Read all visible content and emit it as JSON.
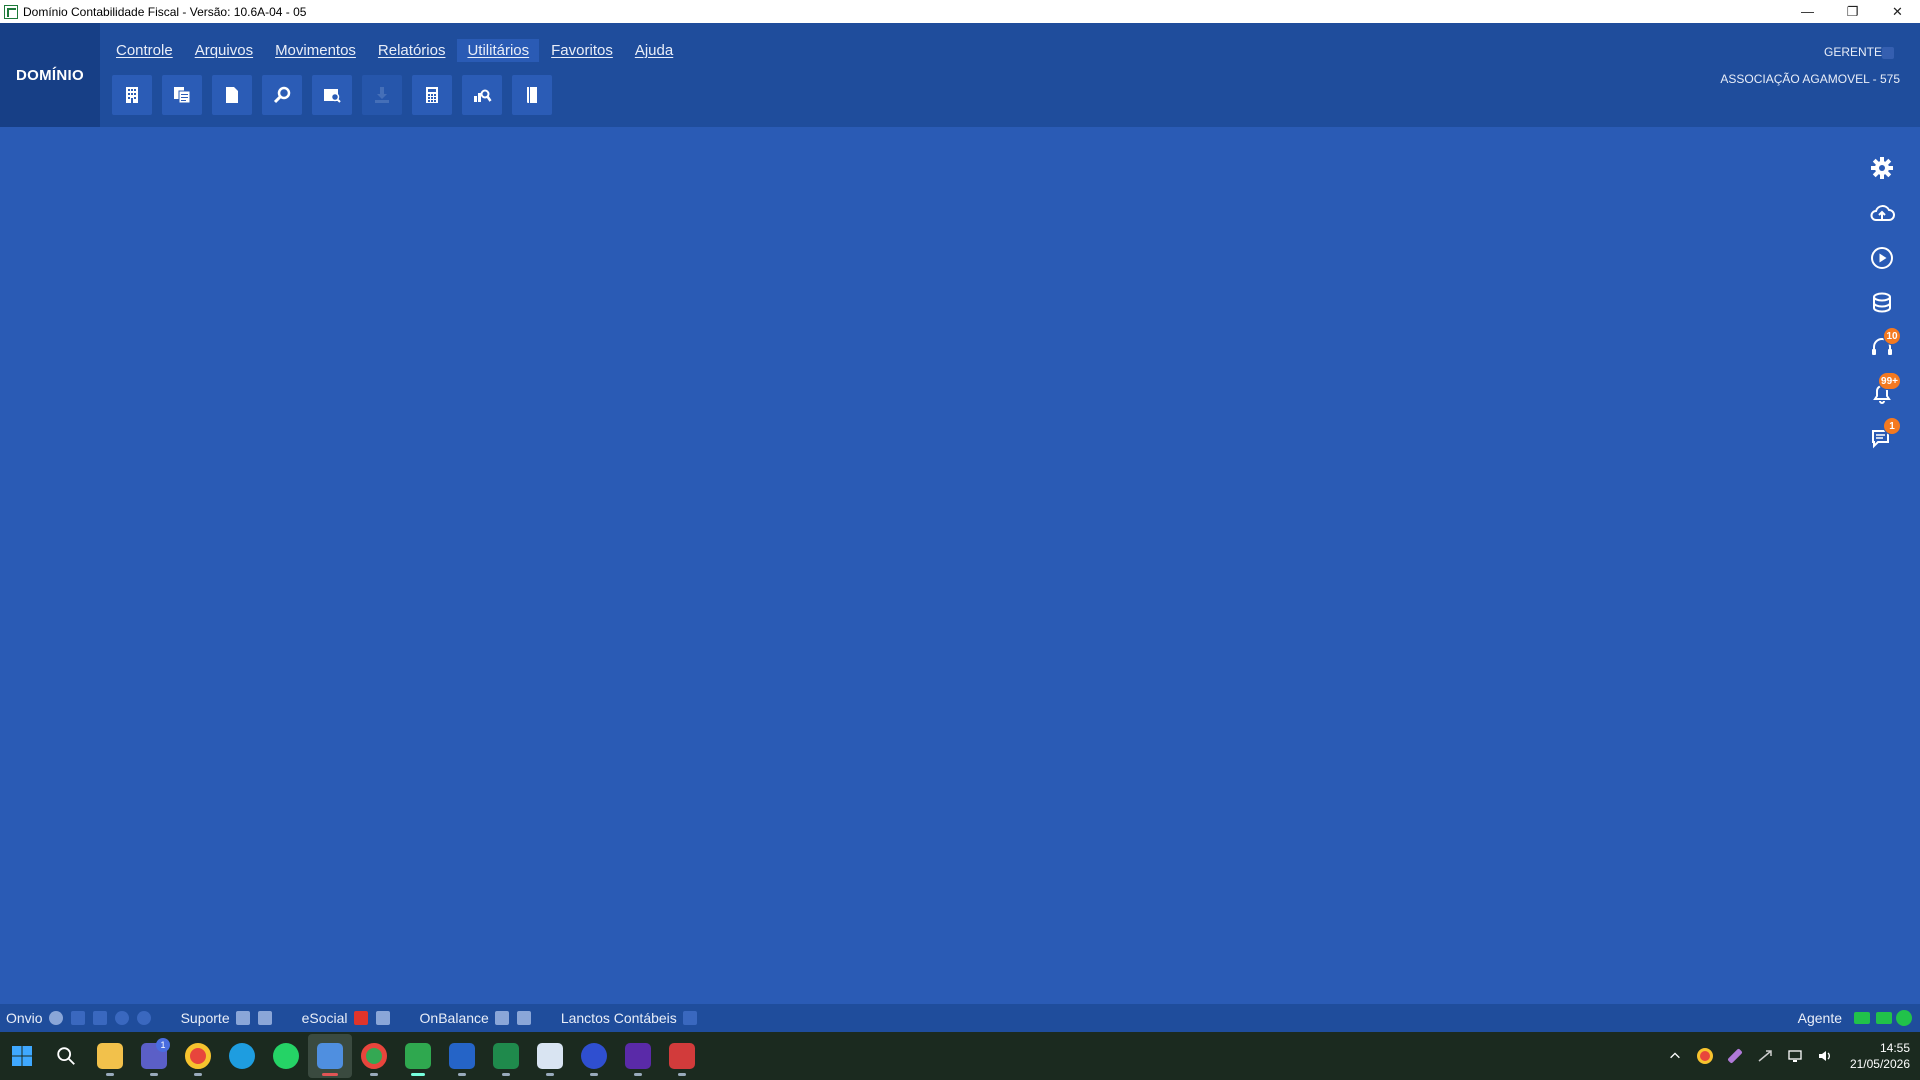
{
  "window": {
    "title": "Domínio Contabilidade Fiscal  - Versão: 10.6A-04 - 05",
    "minimize": "—",
    "restore": "❐",
    "close": "✕"
  },
  "brand": "DOMÍNIO",
  "menu": [
    {
      "label": "Controle"
    },
    {
      "label": "Arquivos"
    },
    {
      "label": "Movimentos"
    },
    {
      "label": "Relatórios"
    },
    {
      "label": "Utilitários"
    },
    {
      "label": "Favoritos"
    },
    {
      "label": "Ajuda"
    }
  ],
  "toolbar_icons": [
    "building-icon",
    "copy-document-icon",
    "document-icon",
    "search-icon",
    "find-document-icon",
    "download-icon",
    "calculator-icon",
    "chart-search-icon",
    "book-icon"
  ],
  "user": {
    "role": "GERENTE",
    "company": "ASSOCIAÇÃO AGAMOVEL  - 575"
  },
  "side_icons": [
    {
      "name": "gear-icon",
      "badge": ""
    },
    {
      "name": "cloud-upload-icon",
      "badge": ""
    },
    {
      "name": "play-circle-icon",
      "badge": ""
    },
    {
      "name": "database-icon",
      "badge": ""
    },
    {
      "name": "headset-icon",
      "badge": "10"
    },
    {
      "name": "bell-icon",
      "badge": "99+"
    },
    {
      "name": "chat-icon",
      "badge": "1"
    }
  ],
  "statusbar": {
    "onvio": "Onvio",
    "suporte": "Suporte",
    "esocial": "eSocial",
    "onbalance": "OnBalance",
    "lanctos": "Lanctos Contábeis",
    "agente": "Agente"
  },
  "taskbar": {
    "time": "14:55",
    "date": "21/05/2026"
  },
  "colors": {
    "workspace": "#2a5bb5",
    "header": "#1f4d9c",
    "brand_block": "#173f86",
    "badge": "#f47920",
    "status_ok": "#21c24a"
  }
}
